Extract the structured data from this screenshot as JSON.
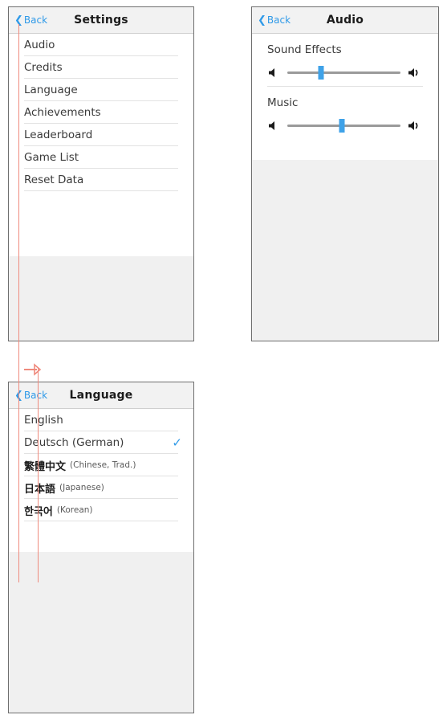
{
  "panels": {
    "settings": {
      "nav": {
        "back_label": "Back",
        "title": "Settings",
        "chevron": "back-chevron-icon"
      },
      "items": [
        {
          "label": "Audio"
        },
        {
          "label": "Credits"
        },
        {
          "label": "Language"
        },
        {
          "label": "Achievements"
        },
        {
          "label": "Leaderboard"
        },
        {
          "label": "Game List"
        },
        {
          "label": "Reset Data"
        }
      ]
    },
    "audio": {
      "nav": {
        "back_label": "Back",
        "title": "Audio",
        "chevron": "back-chevron-icon"
      },
      "groups": [
        {
          "title": "Sound Effects",
          "value": 30,
          "min_icon": "speaker-low-icon",
          "max_icon": "speaker-high-icon"
        },
        {
          "title": "Music",
          "value": 48,
          "min_icon": "speaker-low-icon",
          "max_icon": "speaker-high-icon"
        }
      ]
    },
    "language": {
      "nav": {
        "back_label": "Back",
        "title": "Language",
        "chevron": "back-chevron-icon"
      },
      "items": [
        {
          "label": "English",
          "sub": "",
          "selected": false,
          "cjk": false
        },
        {
          "label": "Deutsch (German)",
          "sub": "",
          "selected": true,
          "cjk": false
        },
        {
          "label": "繁體中文",
          "sub": "(Chinese, Trad.)",
          "selected": false,
          "cjk": true
        },
        {
          "label": "日本語",
          "sub": "(Japanese)",
          "selected": false,
          "cjk": true
        },
        {
          "label": "한국어",
          "sub": "(Korean)",
          "selected": false,
          "cjk": true
        }
      ],
      "check_glyph": "✓"
    }
  },
  "colors": {
    "accent": "#2f9ae8",
    "slider_thumb": "#3fa2e8",
    "annotation": "#ef8a7d",
    "panel_border": "#6e6e6e",
    "navbar_bg": "#f2f2f2",
    "filler_bg": "#f0f0f0"
  },
  "annotations": {
    "flow_arrow": "flow-arrow-icon"
  }
}
